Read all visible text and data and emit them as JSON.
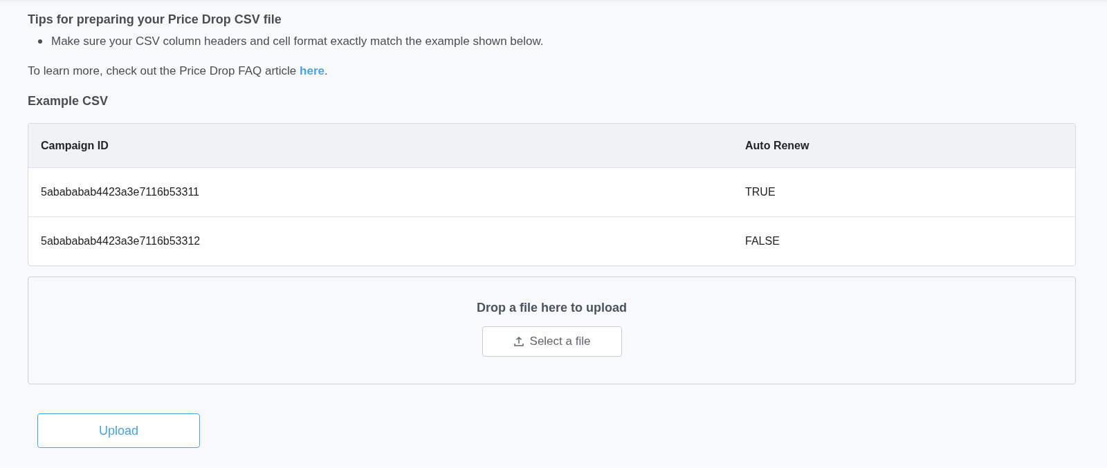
{
  "tips": {
    "title": "Tips for preparing your Price Drop CSV file",
    "bullets": [
      "Make sure your CSV column headers and cell format exactly match the example shown below."
    ],
    "learn_more": {
      "before": "To learn more, check out the Price Drop FAQ article ",
      "link": "here",
      "after": "."
    }
  },
  "example": {
    "title": "Example CSV",
    "columns": [
      "Campaign ID",
      "Auto Renew"
    ],
    "rows": [
      [
        "5abababab4423a3e7116b53311",
        "TRUE"
      ],
      [
        "5abababab4423a3e7116b53312",
        "FALSE"
      ]
    ]
  },
  "dropzone": {
    "label": "Drop a file here to upload",
    "button": "Select a file"
  },
  "upload_button": "Upload"
}
